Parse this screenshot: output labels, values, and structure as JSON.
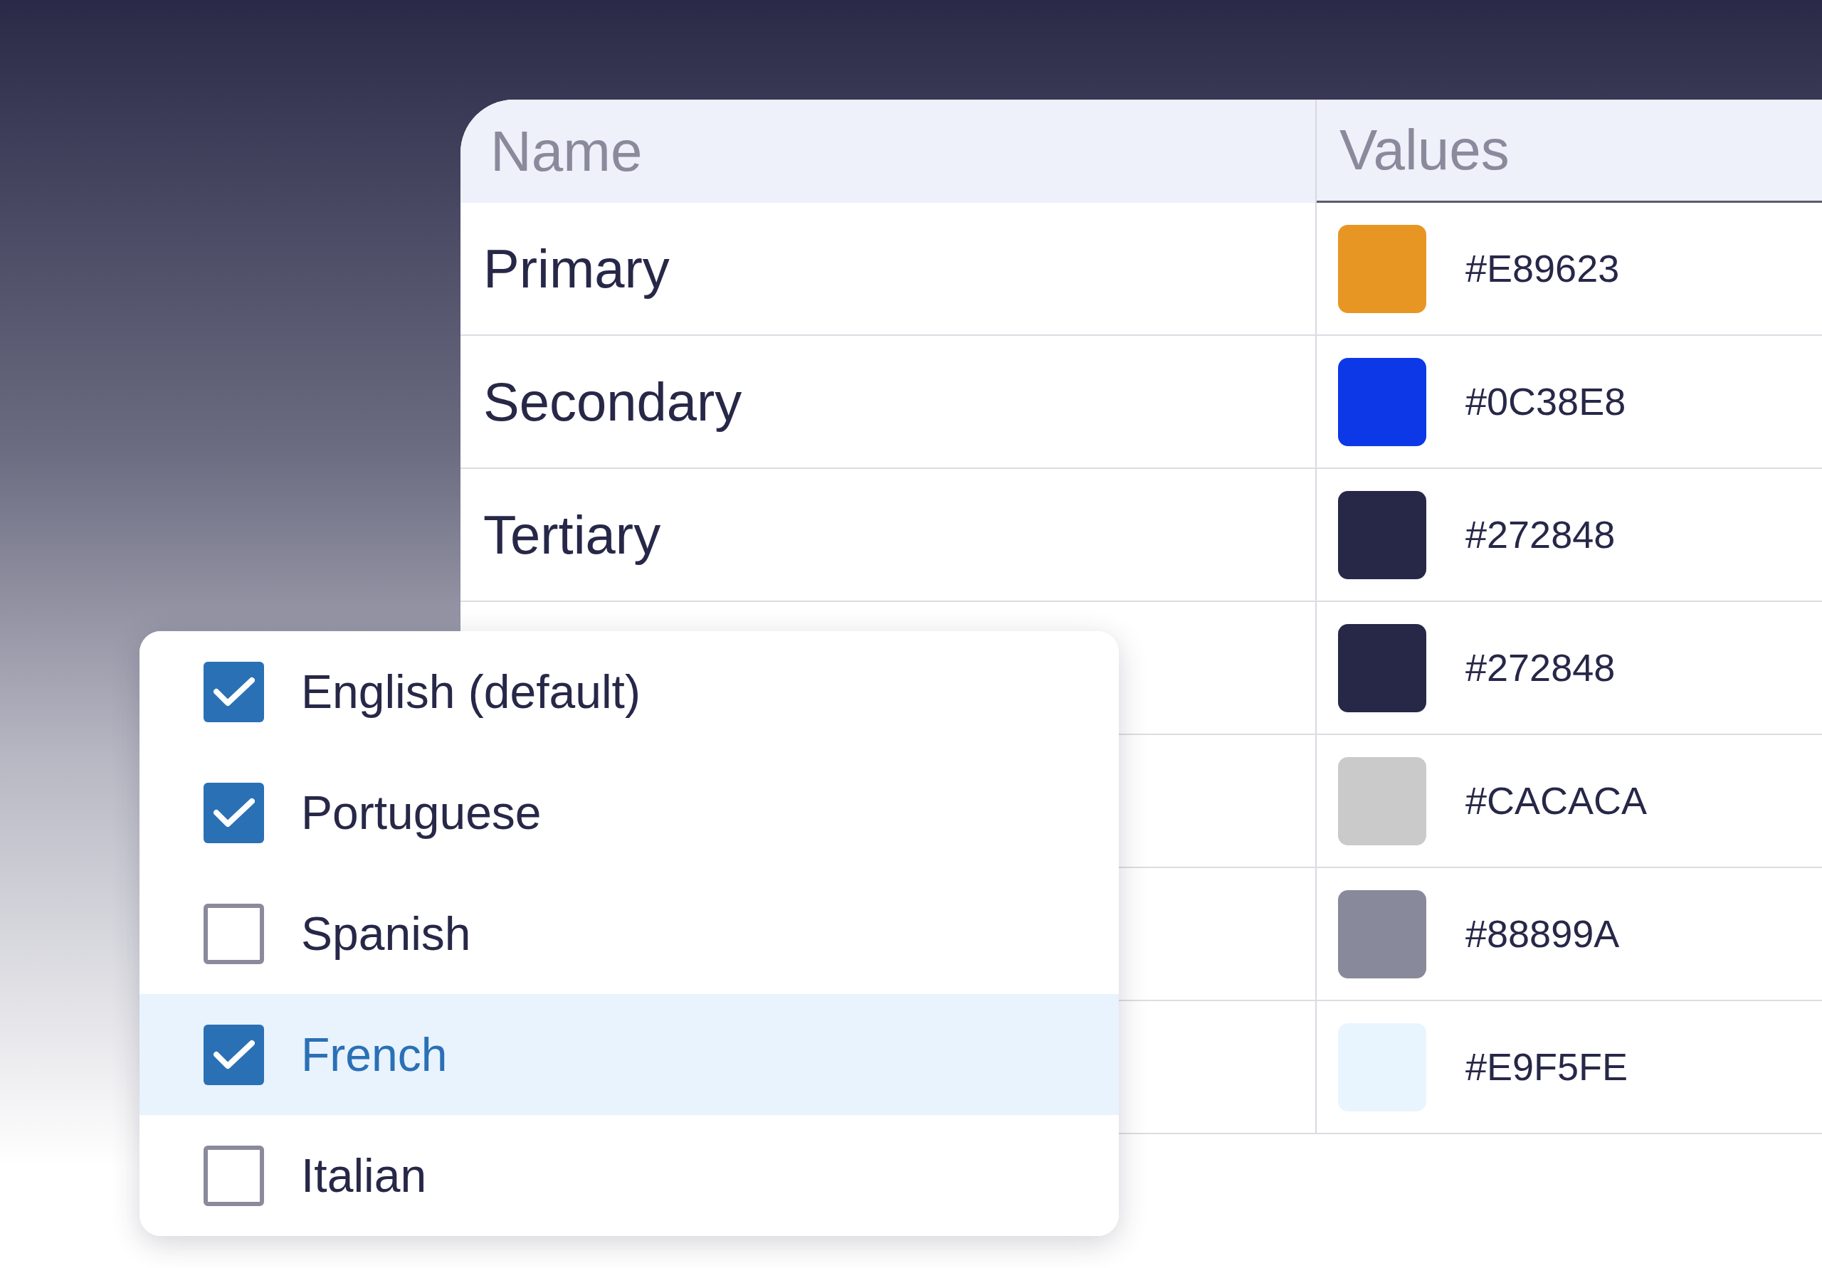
{
  "table": {
    "columns": [
      "Name",
      "Values"
    ],
    "rows": [
      {
        "name": "Primary",
        "value": "#E89623",
        "color": "#e89623"
      },
      {
        "name": "Secondary",
        "value": "#0C38E8",
        "color": "#0c38e8"
      },
      {
        "name": "Tertiary",
        "value": "#272848",
        "color": "#272848"
      },
      {
        "value": "#272848",
        "color": "#272848"
      },
      {
        "value": "#CACACA",
        "color": "#cacaca"
      },
      {
        "value": "#88899A",
        "color": "#88899a"
      },
      {
        "value": "#E9F5FE",
        "color": "#e9f5fe"
      }
    ]
  },
  "language_menu": {
    "items": [
      {
        "label": "English (default)",
        "checked": true,
        "selected": false
      },
      {
        "label": "Portuguese",
        "checked": true,
        "selected": false
      },
      {
        "label": "Spanish",
        "checked": false,
        "selected": false
      },
      {
        "label": "French",
        "checked": true,
        "selected": true
      },
      {
        "label": "Italian",
        "checked": false,
        "selected": false
      }
    ]
  }
}
